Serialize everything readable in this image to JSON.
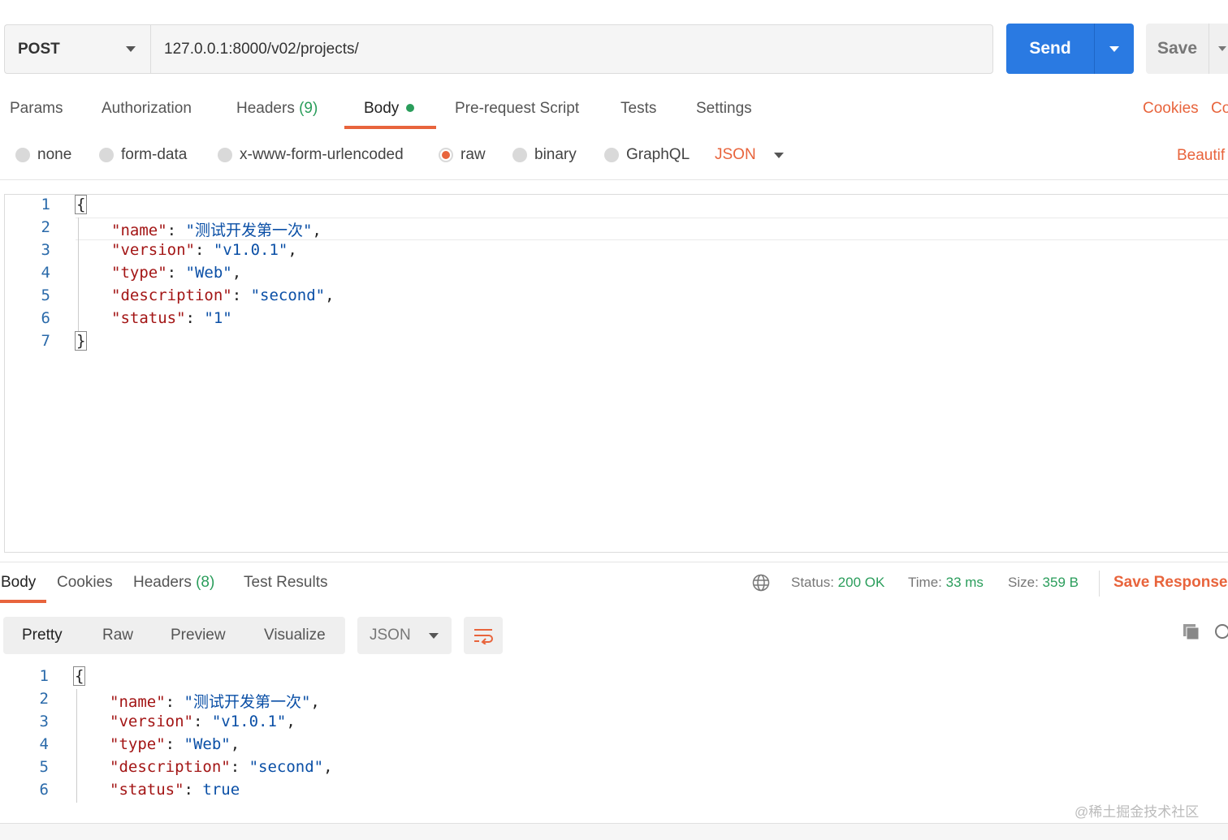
{
  "request": {
    "method": "POST",
    "url": "127.0.0.1:8000/v02/projects/",
    "send_label": "Send",
    "save_label": "Save"
  },
  "request_tabs": {
    "params": "Params",
    "authorization": "Authorization",
    "headers": "Headers",
    "headers_count": "(9)",
    "body": "Body",
    "prerequest": "Pre-request Script",
    "tests": "Tests",
    "settings": "Settings",
    "cookies": "Cookies",
    "code": "Co"
  },
  "body_types": {
    "none": "none",
    "form_data": "form-data",
    "urlencoded": "x-www-form-urlencoded",
    "raw": "raw",
    "binary": "binary",
    "graphql": "GraphQL",
    "format": "JSON",
    "beautify": "Beautif"
  },
  "request_body": {
    "line_numbers": [
      "1",
      "2",
      "3",
      "4",
      "5",
      "6",
      "7"
    ],
    "open": "{",
    "close": "}",
    "fields": [
      {
        "key": "\"name\"",
        "value": "\"测试开发第一次\"",
        "trail": ","
      },
      {
        "key": "\"version\"",
        "value": "\"v1.0.1\"",
        "trail": ","
      },
      {
        "key": "\"type\"",
        "value": "\"Web\"",
        "trail": ","
      },
      {
        "key": "\"description\"",
        "value": "\"second\"",
        "trail": ","
      },
      {
        "key": "\"status\"",
        "value": "\"1\"",
        "trail": ""
      }
    ]
  },
  "response_tabs": {
    "body": "Body",
    "cookies": "Cookies",
    "headers": "Headers",
    "headers_count": "(8)",
    "test_results": "Test Results"
  },
  "response_meta": {
    "status_label": "Status:",
    "status_value": "200 OK",
    "time_label": "Time:",
    "time_value": "33 ms",
    "size_label": "Size:",
    "size_value": "359 B",
    "save_response": "Save Response"
  },
  "response_format": {
    "pretty": "Pretty",
    "raw": "Raw",
    "preview": "Preview",
    "visualize": "Visualize",
    "format": "JSON"
  },
  "response_body": {
    "line_numbers": [
      "1",
      "2",
      "3",
      "4",
      "5",
      "6"
    ],
    "open": "{",
    "fields": [
      {
        "key": "\"name\"",
        "value": "\"测试开发第一次\"",
        "trail": ","
      },
      {
        "key": "\"version\"",
        "value": "\"v1.0.1\"",
        "trail": ","
      },
      {
        "key": "\"type\"",
        "value": "\"Web\"",
        "trail": ","
      },
      {
        "key": "\"description\"",
        "value": "\"second\"",
        "trail": ","
      },
      {
        "key": "\"status\"",
        "value": "true",
        "trail": ""
      }
    ]
  },
  "watermark": "@稀土掘金技术社区",
  "colors": {
    "accent": "#e8643c",
    "send": "#2a7ae2",
    "success": "#2a9d5b",
    "json_key": "#a31515",
    "json_value": "#0a4fa6"
  }
}
